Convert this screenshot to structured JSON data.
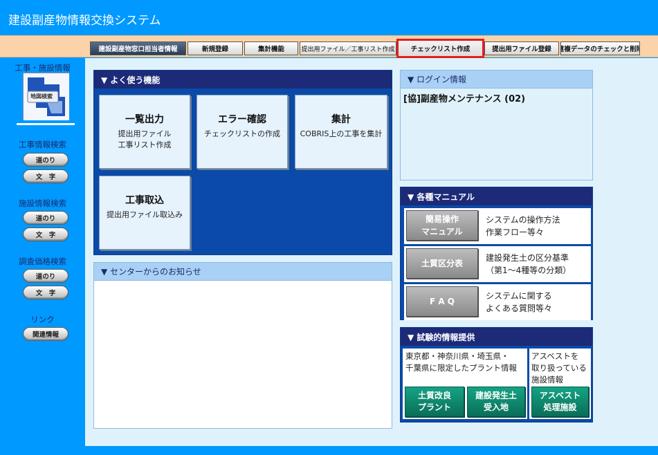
{
  "app": {
    "title": "建設副産物情報交換システム"
  },
  "tabs": [
    {
      "label": "建設副産物窓口担当者情報"
    },
    {
      "label": "新規登録"
    },
    {
      "label": "集計機能"
    },
    {
      "label": "提出用ファイル／工事リスト作成"
    },
    {
      "label": "チェックリスト作成"
    },
    {
      "label": "提出用ファイル登録"
    },
    {
      "label": "重複データのチェックと削除"
    }
  ],
  "sidebar": {
    "construction_info": "工事・施設情報",
    "map_search": "地図検索",
    "groups": [
      {
        "title": "工事情報検索",
        "btn1": "道のり",
        "btn2": "文　字"
      },
      {
        "title": "施設情報検索",
        "btn1": "道のり",
        "btn2": "文　字"
      },
      {
        "title": "調査価格検索",
        "btn1": "道のり",
        "btn2": "文　字"
      }
    ],
    "link_title": "リンク",
    "link_btn": "関連情報"
  },
  "frequent": {
    "title": "▼ よく使う機能",
    "items": [
      {
        "title": "一覧出力",
        "sub1": "提出用ファイル",
        "sub2": "工事リスト作成"
      },
      {
        "title": "エラー確認",
        "sub1": "チェックリストの作成",
        "sub2": ""
      },
      {
        "title": "集計",
        "sub1": "COBRIS上の工事を集計",
        "sub2": ""
      },
      {
        "title": "工事取込",
        "sub1": "提出用ファイル取込み",
        "sub2": ""
      }
    ]
  },
  "notice": {
    "title": "▼ センターからのお知らせ"
  },
  "login": {
    "title": "▼ ログイン情報",
    "user": "[協]副産物メンテナンス (02)"
  },
  "manuals": {
    "title": "▼ 各種マニュアル",
    "items": [
      {
        "btn_l1": "簡易操作",
        "btn_l2": "マニュアル",
        "d1": "システムの操作方法",
        "d2": "作業フロー等々"
      },
      {
        "btn_l1": "土質区分表",
        "btn_l2": "",
        "d1": "建設発生土の区分基準",
        "d2": "（第1～4種等の分類）"
      },
      {
        "btn_l1": "F A Q",
        "btn_l2": "",
        "d1": "システムに関する",
        "d2": "よくある質問等々"
      }
    ]
  },
  "trial": {
    "title": "▼ 試験的情報提供",
    "left_l1": "東京都・神奈川県・埼玉県・",
    "left_l2": "千葉県に限定したプラント情報",
    "right_l1": "アスベストを",
    "right_l2": "取り扱っている",
    "right_l3": "施設情報",
    "btns": [
      {
        "l1": "土質改良",
        "l2": "プラント"
      },
      {
        "l1": "建設発生土",
        "l2": "受入地"
      },
      {
        "l1": "アスベスト",
        "l2": "処理施設"
      }
    ]
  }
}
